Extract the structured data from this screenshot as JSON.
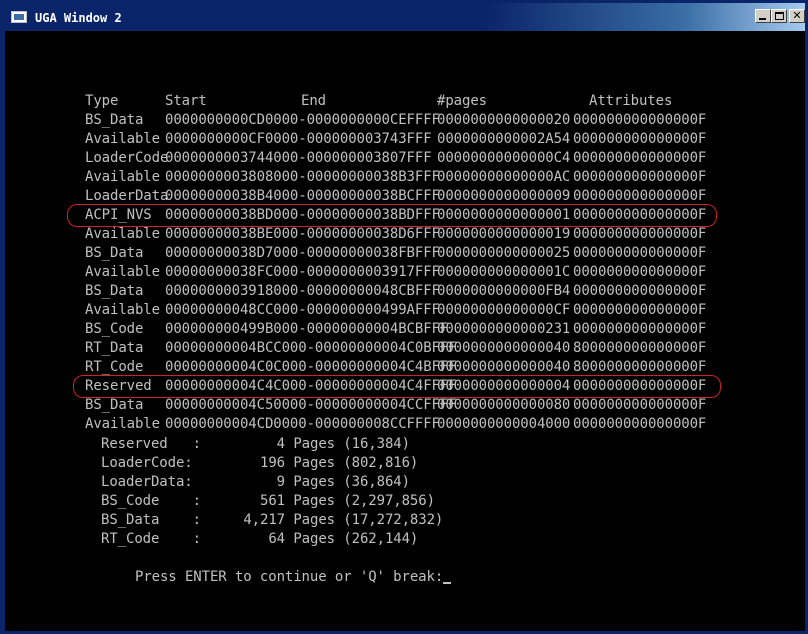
{
  "window": {
    "title": "UGA Window 2"
  },
  "header": {
    "type": "Type",
    "start": "Start",
    "end": "End",
    "pages": "#pages",
    "attributes": "Attributes"
  },
  "rows": [
    {
      "type": "BS_Data",
      "range": "0000000000CD0000-0000000000CEFFFF",
      "pages": "0000000000000020",
      "attr": "000000000000000F"
    },
    {
      "type": "Available",
      "range": "0000000000CF0000-000000003743FFF",
      "pages": "0000000000002A54",
      "attr": "000000000000000F"
    },
    {
      "type": "LoaderCode",
      "range": "0000000003744000-000000003807FFF",
      "pages": "00000000000000C4",
      "attr": "000000000000000F"
    },
    {
      "type": "Available",
      "range": "0000000003808000-00000000038B3FFF",
      "pages": "00000000000000AC",
      "attr": "000000000000000F"
    },
    {
      "type": "LoaderData",
      "range": "00000000038B4000-00000000038BCFFF",
      "pages": "0000000000000009",
      "attr": "000000000000000F"
    },
    {
      "type": "ACPI_NVS",
      "range": "00000000038BD000-00000000038BDFFF",
      "pages": "0000000000000001",
      "attr": "000000000000000F"
    },
    {
      "type": "Available",
      "range": "00000000038BE000-00000000038D6FFF",
      "pages": "0000000000000019",
      "attr": "000000000000000F"
    },
    {
      "type": "BS_Data",
      "range": "00000000038D7000-00000000038FBFFF",
      "pages": "0000000000000025",
      "attr": "000000000000000F"
    },
    {
      "type": "Available",
      "range": "00000000038FC000-0000000003917FFF",
      "pages": "000000000000001C",
      "attr": "000000000000000F"
    },
    {
      "type": "BS_Data",
      "range": "0000000003918000-00000000048CBFFF",
      "pages": "0000000000000FB4",
      "attr": "000000000000000F"
    },
    {
      "type": "Available",
      "range": "00000000048CC000-000000000499AFFF",
      "pages": "00000000000000CF",
      "attr": "000000000000000F"
    },
    {
      "type": "BS_Code",
      "range": "000000000499B000-00000000004BCBFFF",
      "pages": "0000000000000231",
      "attr": "000000000000000F"
    },
    {
      "type": "RT_Data",
      "range": "00000000004BCC000-00000000004C0BFFF",
      "pages": "0000000000000040",
      "attr": "800000000000000F"
    },
    {
      "type": "RT_Code",
      "range": "00000000004C0C000-00000000004C4BFFF",
      "pages": "0000000000000040",
      "attr": "800000000000000F"
    },
    {
      "type": "Reserved",
      "range": "00000000004C4C000-00000000004C4FFFF",
      "pages": "0000000000000004",
      "attr": "000000000000000F"
    },
    {
      "type": "BS_Data",
      "range": "00000000004C50000-00000000004CCFFFF",
      "pages": "0000000000000080",
      "attr": "000000000000000F"
    },
    {
      "type": "Available",
      "range": "00000000004CD0000-000000008CCFFFF",
      "pages": "0000000000004000",
      "attr": "000000000000000F"
    }
  ],
  "summary": [
    {
      "label": "Reserved   :",
      "count": "4",
      "unit": " Pages (16,384)"
    },
    {
      "label": "LoaderCode:",
      "count": "196",
      "unit": " Pages (802,816)"
    },
    {
      "label": "LoaderData:",
      "count": "9",
      "unit": " Pages (36,864)"
    },
    {
      "label": "BS_Code    :",
      "count": "561",
      "unit": " Pages (2,297,856)"
    },
    {
      "label": "BS_Data    :",
      "count": "4,217",
      "unit": " Pages (17,272,832)"
    },
    {
      "label": "RT_Code    :",
      "count": "64",
      "unit": " Pages (262,144)"
    }
  ],
  "prompt": "Press ENTER to continue or 'Q' break:",
  "colors": {
    "text": "#c0c0c0",
    "highlight": "#cc2222",
    "titlebar": "#0a246a"
  }
}
